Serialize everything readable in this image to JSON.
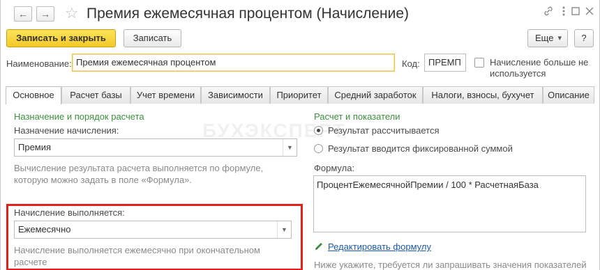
{
  "window": {
    "title": "Премия ежемесячная процентом (Начисление)",
    "back_icon": "arrow-left-icon",
    "forward_icon": "arrow-right-icon",
    "favorite_icon": "star-icon",
    "link_icon": "link-icon",
    "menu_icon": "more-vertical-icon",
    "maximize_icon": "maximize-icon",
    "close_icon": "close-icon"
  },
  "toolbar": {
    "save_close": "Записать и закрыть",
    "save": "Записать",
    "more": "Еще",
    "more_arrow": "▾",
    "help": "?"
  },
  "header": {
    "name_label": "Наименование:",
    "name_value": "Премия ежемесячная процентом",
    "code_label": "Код:",
    "code_value": "ПРЕМП",
    "not_used_label_line1": "Начисление больше не",
    "not_used_label_line2": "используется"
  },
  "tabs": [
    {
      "label": "Основное"
    },
    {
      "label": "Расчет базы"
    },
    {
      "label": "Учет времени"
    },
    {
      "label": "Зависимости"
    },
    {
      "label": "Приоритет"
    },
    {
      "label": "Средний заработок"
    },
    {
      "label": "Налоги, взносы, бухучет"
    },
    {
      "label": "Описание"
    }
  ],
  "left": {
    "section_title": "Назначение и порядок расчета",
    "purpose_label": "Назначение начисления:",
    "purpose_value": "Премия",
    "purpose_hint_line1": "Вычисление результата расчета выполняется по формуле,",
    "purpose_hint_line2": "которую можно задать в поле «Формула».",
    "period_label": "Начисление выполняется:",
    "period_value": "Ежемесячно",
    "period_hint_line1": "Начисление выполняется ежемесячно при окончательном",
    "period_hint_line2": "расчете"
  },
  "right": {
    "section_title": "Расчет и показатели",
    "radio_calculated": "Результат рассчитывается",
    "radio_fixed": "Результат вводится фиксированной суммой",
    "formula_label": "Формула:",
    "formula_value": "ПроцентЕжемесячнойПремии / 100 * РасчетнаяБаза",
    "edit_formula": "Редактировать формулу",
    "bottom_hint": "Ниже укажите, требуется ли запрашивать значения показателей"
  },
  "watermark": "БУХЭКСПЕРТ"
}
